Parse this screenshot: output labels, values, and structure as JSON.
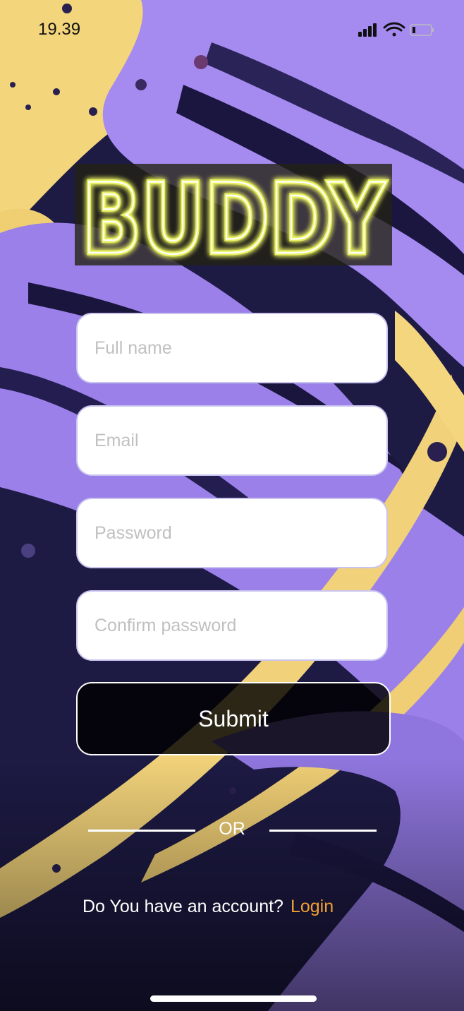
{
  "status_bar": {
    "time": "19.39"
  },
  "logo": {
    "text": "BUDDY"
  },
  "form": {
    "full_name_placeholder": "Full name",
    "email_placeholder": "Email",
    "password_placeholder": "Password",
    "confirm_password_placeholder": "Confirm password",
    "full_name_value": "",
    "email_value": "",
    "password_value": "",
    "confirm_password_value": "",
    "submit_label": "Submit"
  },
  "divider": {
    "label": "OR"
  },
  "footer": {
    "question": "Do You have an account?",
    "login_label": "Login"
  },
  "colors": {
    "accent_login": "#f0a030",
    "field_border": "#c9c4ef",
    "background_purple": "#a98ef0",
    "background_yellow": "#f2d37a",
    "background_navy": "#1a1536"
  },
  "icons": [
    "cellular-signal-icon",
    "wifi-icon",
    "battery-icon"
  ]
}
